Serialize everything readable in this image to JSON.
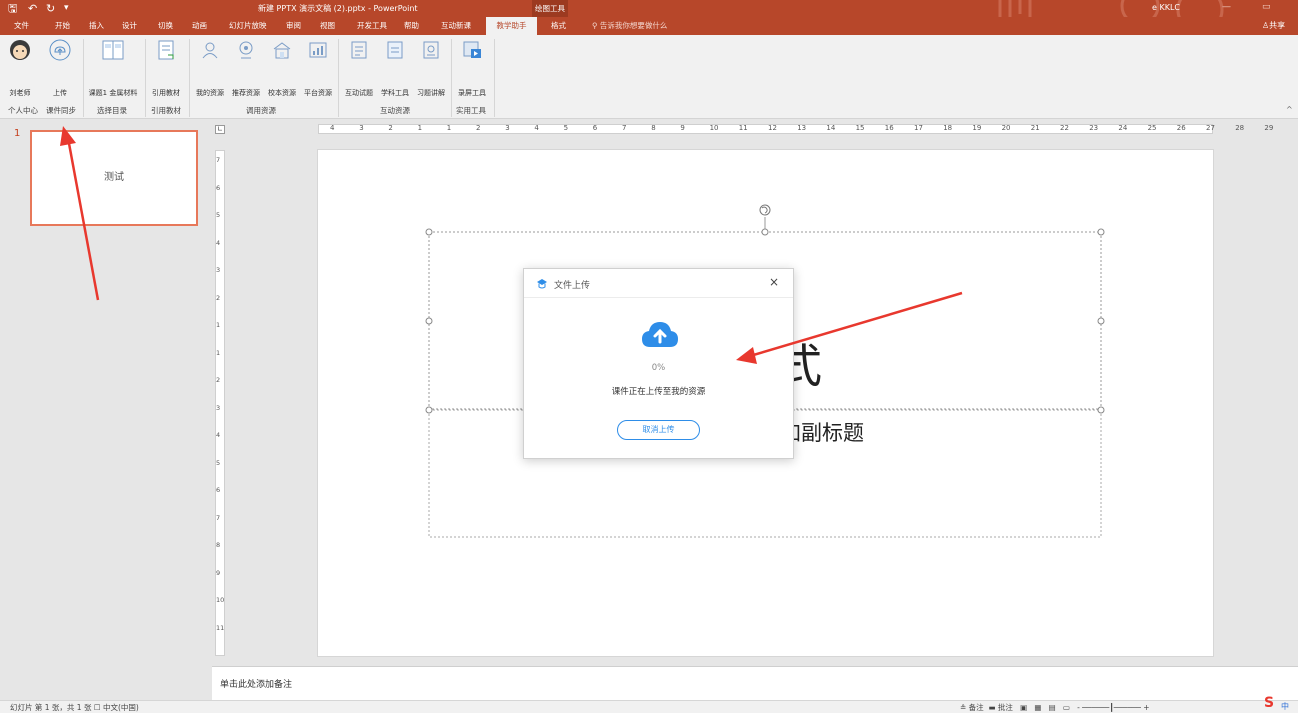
{
  "titlebar": {
    "title": "新建 PPTX 演示文稿 (2).pptx - PowerPoint",
    "context_tools": "绘图工具",
    "user": "e KKLC",
    "quick_access": [
      "save-icon",
      "undo-icon",
      "redo-icon",
      "customize-icon"
    ]
  },
  "tabs": [
    "文件",
    "开始",
    "插入",
    "设计",
    "切换",
    "动画",
    "幻灯片放映",
    "审阅",
    "视图",
    "开发工具",
    "帮助",
    "互动新课",
    "教学助手",
    "格式"
  ],
  "active_tab": "教学助手",
  "tell_me": "告诉我你想要做什么",
  "share": "共享",
  "ribbon": {
    "buttons": [
      "刘老师",
      "上传",
      "课题1 金属材料",
      "引用教材",
      "我的资源",
      "推荐资源",
      "校本资源",
      "平台资源",
      "互动试题",
      "学科工具",
      "习题讲解",
      "录屏工具"
    ],
    "groups": [
      "个人中心",
      "课件同步",
      "选择目录",
      "引用教材",
      "调用资源",
      "互动资源",
      "实用工具"
    ]
  },
  "thumbnail": {
    "number": "1",
    "text": "测试"
  },
  "ruler": {
    "horizontal": [
      "4",
      "3",
      "2",
      "1",
      "1",
      "2",
      "3",
      "4",
      "5",
      "6",
      "7",
      "8",
      "9",
      "10",
      "11",
      "12",
      "13",
      "14",
      "15",
      "16",
      "17",
      "18",
      "19",
      "20",
      "21",
      "22",
      "23",
      "24",
      "25",
      "26",
      "27",
      "28",
      "29"
    ],
    "vertical": [
      "7",
      "6",
      "5",
      "4",
      "3",
      "2",
      "1",
      "1",
      "2",
      "3",
      "4",
      "5",
      "6",
      "7",
      "8",
      "9",
      "10",
      "11"
    ]
  },
  "slide": {
    "title_fragment": "式",
    "subtitle_fragment": "加副标题"
  },
  "notes": "单击此处添加备注",
  "status": {
    "left": "幻灯片 第 1 张，共 1 张",
    "language": "中文(中国)",
    "notes_btn": "备注",
    "comments_btn": "批注"
  },
  "dialog": {
    "title": "文件上传",
    "percent": "0%",
    "progress": 0,
    "message": "课件正在上传至我的资源",
    "cancel": "取消上传"
  },
  "colors": {
    "brand": "#b7472a",
    "accent_blue": "#2e8de8",
    "arrow_red": "#e8382e"
  }
}
